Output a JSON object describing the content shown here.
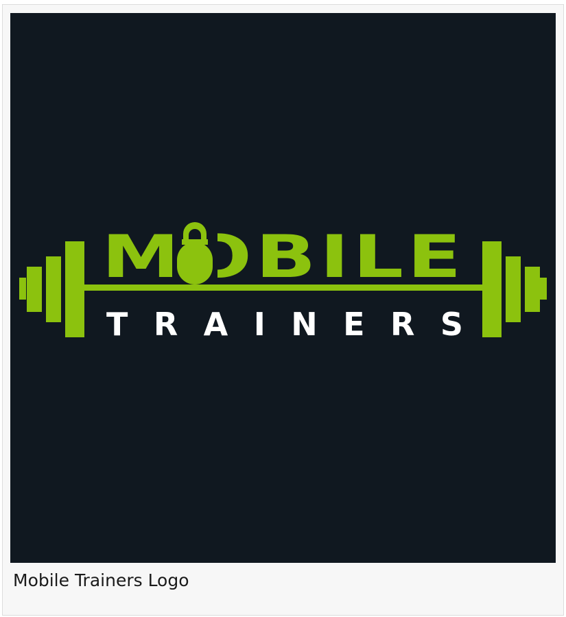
{
  "logo": {
    "word_main": "MOBILE",
    "word_sub": "TRAINERS",
    "colors": {
      "background": "#101820",
      "accent": "#8cc20e",
      "text_light": "#ffffff"
    },
    "icons": [
      "barbell-icon",
      "kettlebell-icon"
    ]
  },
  "caption": "Mobile Trainers Logo"
}
